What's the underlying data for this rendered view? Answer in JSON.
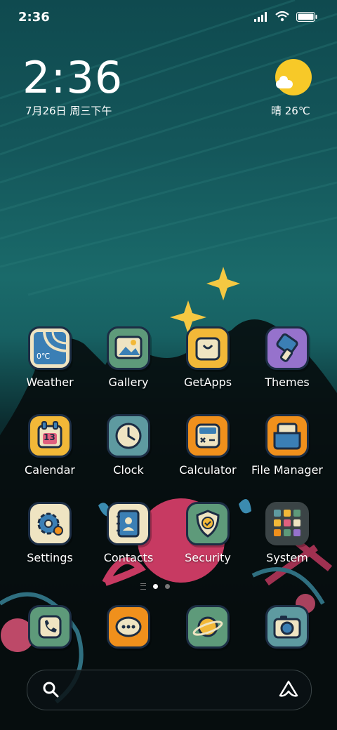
{
  "status_bar": {
    "time": "2:36"
  },
  "widget": {
    "clock": "2:36",
    "date": "7月26日 周三下午",
    "weather": "晴 26℃"
  },
  "apps": [
    {
      "id": "weather",
      "label": "Weather",
      "icon": "weather-icon",
      "bg": "#efe4c2",
      "badge": "0℃"
    },
    {
      "id": "gallery",
      "label": "Gallery",
      "icon": "gallery-icon",
      "bg": "#5e9a7a"
    },
    {
      "id": "getapps",
      "label": "GetApps",
      "icon": "getapps-icon",
      "bg": "#f2b838"
    },
    {
      "id": "themes",
      "label": "Themes",
      "icon": "themes-icon",
      "bg": "#9672cc"
    },
    {
      "id": "calendar",
      "label": "Calendar",
      "icon": "calendar-icon",
      "bg": "#f2b838",
      "day": "13"
    },
    {
      "id": "clock",
      "label": "Clock",
      "icon": "clock-icon",
      "bg": "#5e9aa0"
    },
    {
      "id": "calculator",
      "label": "Calculator",
      "icon": "calculator-icon",
      "bg": "#f0901c"
    },
    {
      "id": "filemanager",
      "label": "File Manager",
      "icon": "folder-icon",
      "bg": "#f0901c"
    },
    {
      "id": "settings",
      "label": "Settings",
      "icon": "gear-icon",
      "bg": "#efe4c2"
    },
    {
      "id": "contacts",
      "label": "Contacts",
      "icon": "contacts-icon",
      "bg": "#efe4c2"
    },
    {
      "id": "security",
      "label": "Security",
      "icon": "shield-icon",
      "bg": "#5e9a7a"
    },
    {
      "id": "system",
      "label": "System",
      "icon": "folder-grid-icon",
      "bg": "#3b4446"
    }
  ],
  "dock": [
    {
      "id": "phone",
      "icon": "phone-icon",
      "bg": "#5e9a7a"
    },
    {
      "id": "messages",
      "icon": "messages-icon",
      "bg": "#f0901c"
    },
    {
      "id": "browser",
      "icon": "browser-icon",
      "bg": "#5e9a7a"
    },
    {
      "id": "camera",
      "icon": "camera-icon",
      "bg": "#5e9aa0"
    }
  ],
  "page_indicator": {
    "pages": 2,
    "current": 1
  }
}
